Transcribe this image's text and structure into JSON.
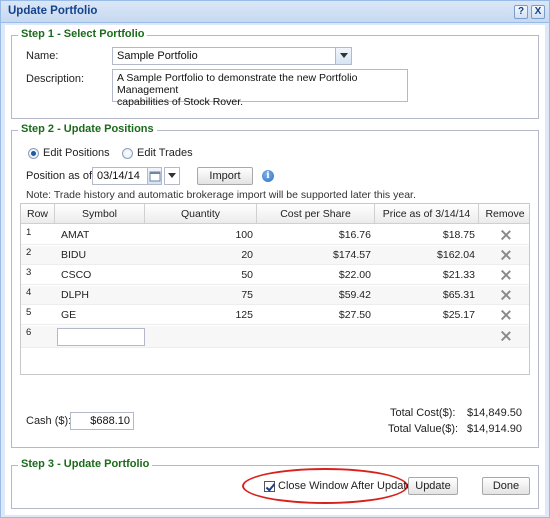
{
  "window": {
    "title": "Update Portfolio",
    "help_glyph": "?",
    "close_glyph": "X"
  },
  "step1": {
    "legend": "Step 1 - Select Portfolio",
    "name_label": "Name:",
    "name_value": "Sample Portfolio",
    "description_label": "Description:",
    "description_line1": "A Sample Portfolio to demonstrate the new Portfolio Management",
    "description_line2": "capabilities of Stock Rover."
  },
  "step2": {
    "legend": "Step 2 - Update Positions",
    "radio_edit_positions": "Edit Positions",
    "radio_edit_trades": "Edit Trades",
    "selected_mode": "Edit Positions",
    "position_as_of_label": "Position as of",
    "position_date": "03/14/14",
    "import_label": "Import",
    "note": "Note: Trade history and automatic brokerage import will be supported later this year.",
    "columns": [
      "Row",
      "Symbol",
      "Quantity",
      "Cost per Share",
      "Price as of 3/14/14",
      "Remove"
    ],
    "rows": [
      {
        "row": "1",
        "symbol": "AMAT",
        "quantity": "100",
        "cost": "$16.76",
        "price": "$18.75"
      },
      {
        "row": "2",
        "symbol": "BIDU",
        "quantity": "20",
        "cost": "$174.57",
        "price": "$162.04"
      },
      {
        "row": "3",
        "symbol": "CSCO",
        "quantity": "50",
        "cost": "$22.00",
        "price": "$21.33"
      },
      {
        "row": "4",
        "symbol": "DLPH",
        "quantity": "75",
        "cost": "$59.42",
        "price": "$65.31"
      },
      {
        "row": "5",
        "symbol": "GE",
        "quantity": "125",
        "cost": "$27.50",
        "price": "$25.17"
      },
      {
        "row": "6",
        "symbol": "",
        "quantity": "",
        "cost": "",
        "price": ""
      }
    ],
    "cash_label": "Cash ($):",
    "cash_value": "$688.10",
    "total_cost_label": "Total Cost($):",
    "total_cost_value": "$14,849.50",
    "total_value_label": "Total Value($):",
    "total_value_value": "$14,914.90"
  },
  "step3": {
    "legend": "Step 3 - Update Portfolio",
    "close_after_update_label": "Close Window After Update",
    "close_after_update_checked": true,
    "update_label": "Update",
    "done_label": "Done"
  },
  "colors": {
    "legend_green": "#1a6b1a",
    "title_blue": "#15428b",
    "highlight_red": "#d9211c"
  },
  "icons": {
    "calendar": "calendar-icon",
    "info": "info-icon",
    "remove": "remove-x-icon",
    "help": "help-icon",
    "close": "close-icon"
  }
}
